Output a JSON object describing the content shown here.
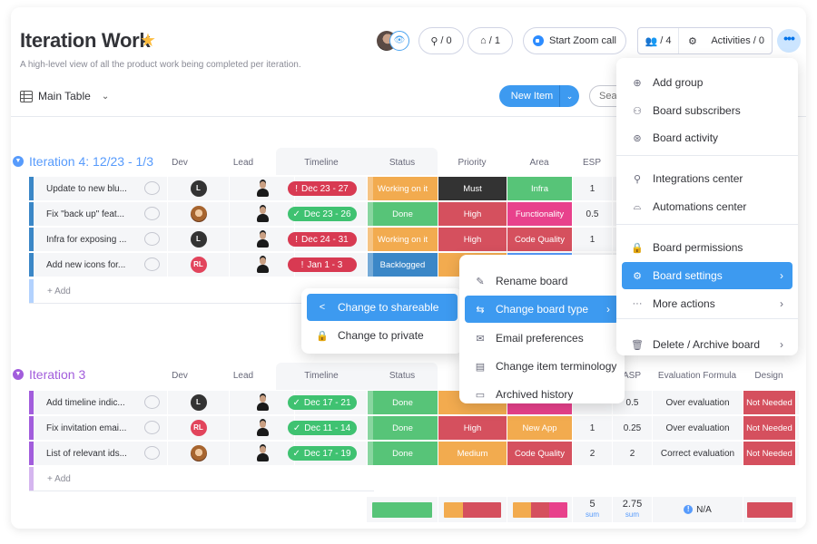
{
  "board": {
    "title": "Iteration Work",
    "description": "A high-level view of all the product work being completed per iteration.",
    "view_label": "Main Table"
  },
  "header": {
    "integrations_count": "/ 0",
    "automations_count": "/ 1",
    "zoom_label": "Start Zoom call",
    "members_count": "/ 4",
    "activities_label": "Activities / 0",
    "more_label": "•••"
  },
  "toolbar": {
    "new_item_label": "New Item",
    "search_placeholder": "Search"
  },
  "colors": {
    "accent": "#3d9af0",
    "group4": "#579bfc",
    "group3": "#a25ddc",
    "done": "#57c478",
    "working": "#f2ab4f",
    "stuck": "#d5505e",
    "backlogged": "#3b87c7",
    "must": "#333333",
    "functionality": "#e8418c"
  },
  "groups": [
    {
      "title": "Iteration 4: 12/23 - 1/3",
      "columns": [
        "Dev",
        "Lead",
        "Timeline",
        "Status",
        "Priority",
        "Area",
        "ESP"
      ],
      "rows": [
        {
          "name": "Update to new blu...",
          "dev": "L",
          "timeline": "Dec 23 - 27",
          "timeline_state": "overdue",
          "status": "Working on it",
          "priority": "Must",
          "area": "Infra",
          "esp": "1"
        },
        {
          "name": "Fix \"back up\" feat...",
          "dev": "photo",
          "timeline": "Dec 23 - 26",
          "timeline_state": "done",
          "status": "Done",
          "priority": "High",
          "area": "Functionality",
          "esp": "0.5"
        },
        {
          "name": "Infra for exposing ...",
          "dev": "L",
          "timeline": "Dec 24 - 31",
          "timeline_state": "overdue",
          "status": "Working on it",
          "priority": "High",
          "area": "Code Quality",
          "esp": "1"
        },
        {
          "name": "Add new icons for...",
          "dev": "RL",
          "timeline": "Jan 1 - 3",
          "timeline_state": "overdue",
          "status": "Backlogged",
          "priority": "",
          "area": "",
          "esp": ""
        }
      ],
      "add_label": "+ Add"
    },
    {
      "title": "Iteration 3",
      "columns": [
        "Dev",
        "Lead",
        "Timeline",
        "Status",
        "ASP",
        "Evaluation Formula",
        "Design"
      ],
      "rows": [
        {
          "name": "Add timeline indic...",
          "dev": "L",
          "timeline": "Dec 17 - 21",
          "timeline_state": "done",
          "status": "Done",
          "priority": "",
          "area": "",
          "esp": "",
          "asp": "0.5",
          "evaluation": "Over evaluation",
          "design": "Not Needed"
        },
        {
          "name": "Fix invitation emai...",
          "dev": "RL",
          "timeline": "Dec 11 - 14",
          "timeline_state": "done",
          "status": "Done",
          "priority": "High",
          "area": "New App",
          "esp": "1",
          "asp": "0.25",
          "evaluation": "Over evaluation",
          "design": "Not Needed"
        },
        {
          "name": "List of relevant ids...",
          "dev": "photo",
          "timeline": "Dec 17 - 19",
          "timeline_state": "done",
          "status": "Done",
          "priority": "Medium",
          "area": "Code Quality",
          "esp": "2",
          "asp": "2",
          "evaluation": "Correct evaluation",
          "design": "Not Needed"
        }
      ],
      "add_label": "+ Add",
      "summary": {
        "esp_sum": "5",
        "asp_sum": "2.75",
        "sum_label": "sum",
        "evaluation": "N/A"
      }
    }
  ],
  "main_menu": {
    "items": [
      {
        "label": "Add group",
        "icon": "plus-circle-icon"
      },
      {
        "label": "Board subscribers",
        "icon": "users-icon"
      },
      {
        "label": "Board activity",
        "icon": "activity-icon"
      },
      {
        "label": "Integrations center",
        "icon": "integrations-icon"
      },
      {
        "label": "Automations center",
        "icon": "robot-icon"
      },
      {
        "label": "Board permissions",
        "icon": "lock-icon"
      },
      {
        "label": "Board settings",
        "icon": "gear-icon"
      },
      {
        "label": "More actions",
        "icon": "dots-icon"
      },
      {
        "label": "Delete / Archive board",
        "icon": "trash-icon"
      }
    ]
  },
  "settings_menu": {
    "items": [
      {
        "label": "Rename board",
        "icon": "pencil-icon"
      },
      {
        "label": "Change board type",
        "icon": "swap-icon"
      },
      {
        "label": "Email preferences",
        "icon": "mail-icon"
      },
      {
        "label": "Change item terminology",
        "icon": "id-card-icon"
      },
      {
        "label": "Archived history",
        "icon": "archive-icon"
      }
    ]
  },
  "type_menu": {
    "items": [
      {
        "label": "Change to shareable",
        "icon": "share-icon"
      },
      {
        "label": "Change to private",
        "icon": "lock-icon"
      }
    ]
  }
}
